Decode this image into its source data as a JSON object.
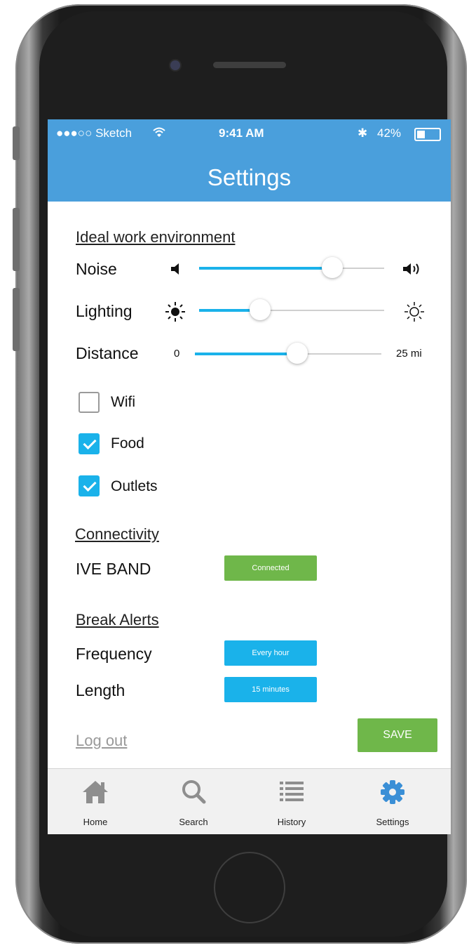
{
  "status_bar": {
    "carrier": "●●●○○ Sketch",
    "time": "9:41 AM",
    "battery": "42%"
  },
  "header": {
    "title": "Settings"
  },
  "environment": {
    "section_title": "Ideal work environment",
    "sliders": [
      {
        "label": "Noise",
        "value": 0.72,
        "min_icon": "volume-low-icon",
        "max_icon": "volume-high-icon"
      },
      {
        "label": "Lighting",
        "value": 0.33,
        "min_icon": "sun-dark-icon",
        "max_icon": "sun-bright-icon"
      },
      {
        "label": "Distance",
        "value": 0.55,
        "min_label": "0",
        "max_label": "25 mi"
      }
    ],
    "checkboxes": [
      {
        "label": "Wifi",
        "checked": false
      },
      {
        "label": "Food",
        "checked": true
      },
      {
        "label": "Outlets",
        "checked": true
      }
    ]
  },
  "connectivity": {
    "section_title": "Connectivity",
    "device_label": "IVE BAND",
    "status": "Connected"
  },
  "break_alerts": {
    "section_title": "Break Alerts",
    "frequency_label": "Frequency",
    "frequency_value": "Every hour",
    "length_label": "Length",
    "length_value": "15 minutes"
  },
  "actions": {
    "logout": "Log out",
    "save": "SAVE"
  },
  "tabs": [
    {
      "label": "Home",
      "icon": "home-icon"
    },
    {
      "label": "Search",
      "icon": "search-icon"
    },
    {
      "label": "History",
      "icon": "list-icon"
    },
    {
      "label": "Settings",
      "icon": "gear-icon",
      "active": true
    }
  ],
  "colors": {
    "accent": "#1ab2ea",
    "header": "#4a9fdc",
    "success": "#6fb74a",
    "tab_active": "#3a8fd6"
  }
}
